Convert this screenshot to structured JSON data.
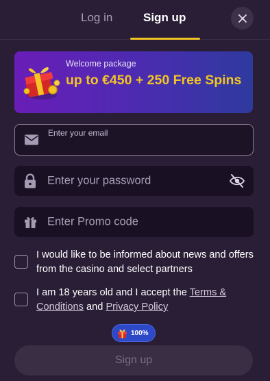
{
  "tabs": {
    "login": "Log in",
    "signup": "Sign up",
    "active": "signup"
  },
  "banner": {
    "small": "Welcome package",
    "big": "up to €450 + 250 Free Spins"
  },
  "email": {
    "label": "Enter your email",
    "value": ""
  },
  "password": {
    "placeholder": "Enter your password"
  },
  "promo": {
    "placeholder": "Enter Promo code"
  },
  "checks": {
    "news": "I would like to be informed about news and offers from the casino and select partners",
    "age_prefix": "I am 18 years old and I accept the ",
    "terms": "Terms & Conditions",
    "and": " and ",
    "privacy": "Privacy Policy"
  },
  "badge": {
    "text": "100%",
    "progress": 1.0
  },
  "submit": {
    "label": "Sign up"
  },
  "colors": {
    "accent": "#f2c524",
    "bg": "#2a1e36",
    "badge": "#2d49c8"
  }
}
